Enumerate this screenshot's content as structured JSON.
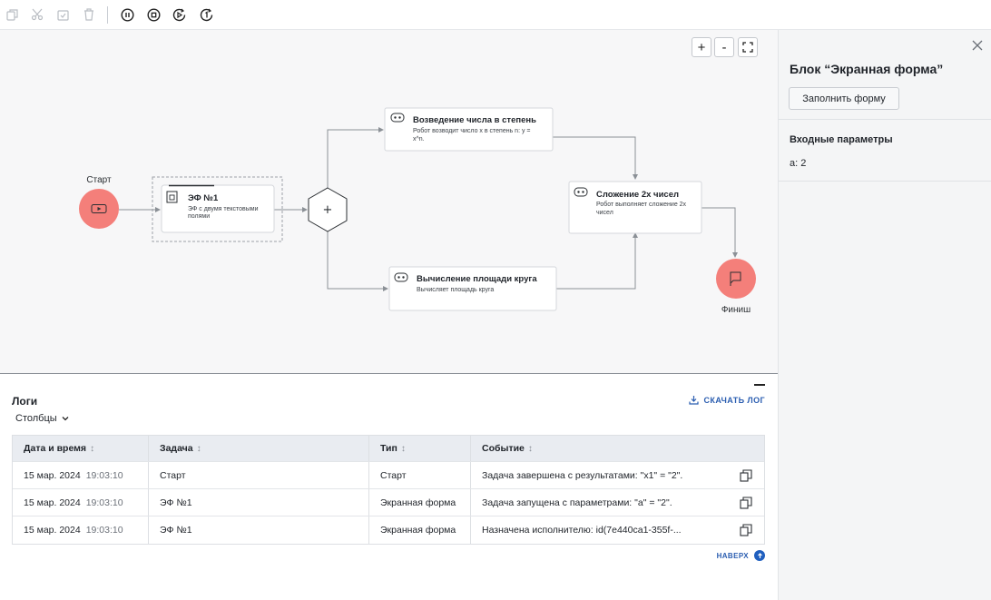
{
  "toolbar": {
    "icons": [
      "copy-icon",
      "cut-icon",
      "paste-icon",
      "delete-icon",
      "pause-icon",
      "stop-icon",
      "run-step-icon",
      "run-once-icon"
    ]
  },
  "canvas": {
    "zoom": {
      "plus": "+",
      "minus": "-"
    },
    "start": {
      "label": "Старт"
    },
    "finish": {
      "label": "Финиш"
    },
    "gateway": {
      "symbol": "+"
    },
    "nodes": {
      "form1": {
        "title": "ЭФ №1",
        "desc1": "ЭФ с двумя текстовыми",
        "desc2": "полями"
      },
      "power": {
        "title": "Возведение числа в степень",
        "desc1": "Робот возводит число x в степень n: y =",
        "desc2": "x^n."
      },
      "circle": {
        "title": "Вычисление площади круга",
        "desc1": "Вычисляет площадь круга"
      },
      "sum": {
        "title": "Сложение 2х чисел",
        "desc1": "Робот выполняет сложение 2х",
        "desc2": "чисел"
      }
    }
  },
  "panel": {
    "title": "Блок “Экранная форма”",
    "fill_button": "Заполнить форму",
    "input_params_title": "Входные параметры",
    "param": "a: 2"
  },
  "logs": {
    "title": "Логи",
    "columns_label": "Столбцы",
    "download_label": "СКАЧАТЬ ЛОГ",
    "top_label": "НАВЕРХ",
    "headers": {
      "datetime": "Дата и время",
      "task": "Задача",
      "type": "Тип",
      "event": "Событие"
    },
    "rows": [
      {
        "date": "15 мар. 2024",
        "time": "19:03:10",
        "task": "Старт",
        "type": "Старт",
        "event": "Задача завершена с результатами: \"x1\" = \"2\"."
      },
      {
        "date": "15 мар. 2024",
        "time": "19:03:10",
        "task": "ЭФ №1",
        "type": "Экранная форма",
        "event": "Задача запущена с параметрами: \"a\" = \"2\"."
      },
      {
        "date": "15 мар. 2024",
        "time": "19:03:10",
        "task": "ЭФ №1",
        "type": "Экранная форма",
        "event": "Назначена исполнителю: id(7e440ca1-355f-..."
      }
    ]
  },
  "colors": {
    "accent": "#2a5db0",
    "event_circle": "#f47f7a",
    "canvas_bg": "#f7f7f8",
    "table_header": "#e9ecf1"
  }
}
